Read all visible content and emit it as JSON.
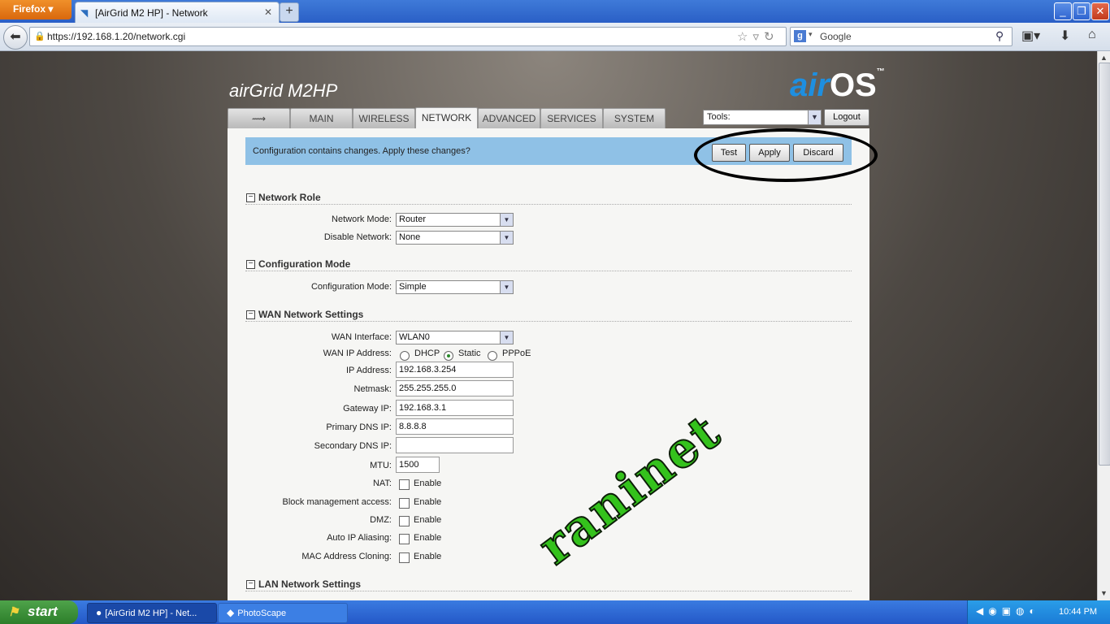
{
  "browser": {
    "menu_label": "Firefox",
    "tab_title": "[AirGrid M2 HP] - Network",
    "new_tab": "+",
    "url": "https://192.168.1.20/network.cgi",
    "search_engine": "Google",
    "window_controls": [
      "_",
      "❐",
      "✕"
    ]
  },
  "app": {
    "brand_left": "airGrid M2HP",
    "brand_right_air": "air",
    "brand_right_os": "OS",
    "brand_tm": "™",
    "tabs": [
      {
        "label": "",
        "icon": "ubiquiti-logo-icon"
      },
      {
        "label": "MAIN"
      },
      {
        "label": "WIRELESS"
      },
      {
        "label": "NETWORK",
        "active": true
      },
      {
        "label": "ADVANCED"
      },
      {
        "label": "SERVICES"
      },
      {
        "label": "SYSTEM"
      }
    ],
    "tools_label": "Tools:",
    "logout_label": "Logout"
  },
  "notice": {
    "message": "Configuration contains changes. Apply these changes?",
    "test_label": "Test",
    "apply_label": "Apply",
    "discard_label": "Discard"
  },
  "network_role": {
    "title": "Network Role",
    "network_mode_label": "Network Mode:",
    "network_mode_value": "Router",
    "disable_network_label": "Disable Network:",
    "disable_network_value": "None"
  },
  "configuration_mode": {
    "title": "Configuration Mode",
    "label": "Configuration Mode:",
    "value": "Simple"
  },
  "wan": {
    "title": "WAN Network Settings",
    "interface_label": "WAN Interface:",
    "interface_value": "WLAN0",
    "ip_address_mode_label": "WAN IP Address:",
    "modes": [
      "DHCP",
      "Static",
      "PPPoE"
    ],
    "selected_mode": "Static",
    "ip_address_label": "IP Address:",
    "ip_address_value": "192.168.3.254",
    "netmask_label": "Netmask:",
    "netmask_value": "255.255.255.0",
    "gateway_label": "Gateway IP:",
    "gateway_value": "192.168.3.1",
    "primary_dns_label": "Primary DNS IP:",
    "primary_dns_value": "8.8.8.8",
    "secondary_dns_label": "Secondary DNS IP:",
    "secondary_dns_value": "",
    "mtu_label": "MTU:",
    "mtu_value": "1500",
    "options": [
      {
        "label": "NAT:",
        "check_label": "Enable"
      },
      {
        "label": "Block management access:",
        "check_label": "Enable"
      },
      {
        "label": "DMZ:",
        "check_label": "Enable"
      },
      {
        "label": "Auto IP Aliasing:",
        "check_label": "Enable"
      },
      {
        "label": "MAC Address Cloning:",
        "check_label": "Enable"
      }
    ]
  },
  "lan": {
    "title": "LAN Network Settings"
  },
  "watermark": "raninet",
  "taskbar": {
    "start_label": "start",
    "items": [
      "[AirGrid M2 HP] - Net...",
      "PhotoScape"
    ],
    "clock": "10:44 PM"
  }
}
